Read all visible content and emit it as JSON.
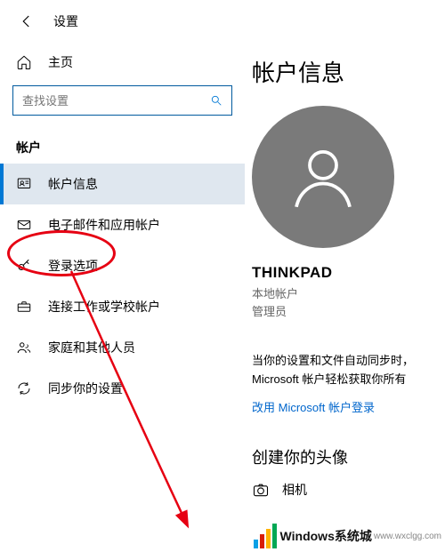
{
  "header": {
    "title": "设置"
  },
  "sidebar": {
    "home_label": "主页",
    "search_placeholder": "查找设置",
    "section_label": "帐户",
    "items": [
      {
        "label": "帐户信息",
        "icon": "account-info-icon",
        "selected": true
      },
      {
        "label": "电子邮件和应用帐户",
        "icon": "mail-icon",
        "selected": false
      },
      {
        "label": "登录选项",
        "icon": "key-icon",
        "selected": false
      },
      {
        "label": "连接工作或学校帐户",
        "icon": "briefcase-icon",
        "selected": false
      },
      {
        "label": "家庭和其他人员",
        "icon": "people-icon",
        "selected": false
      },
      {
        "label": "同步你的设置",
        "icon": "sync-icon",
        "selected": false
      }
    ]
  },
  "main": {
    "title": "帐户信息",
    "user": {
      "name": "THINKPAD",
      "type": "本地帐户",
      "role": "管理员"
    },
    "paragraph": "当你的设置和文件自动同步时，Microsoft 帐户轻松获取你所有",
    "link": "改用 Microsoft 帐户登录",
    "subhead": "创建你的头像",
    "camera_label": "相机"
  },
  "watermark": {
    "text1": "Windows系统城",
    "text2": "www.wxclgg.com"
  },
  "colors": {
    "accent": "#0078d4",
    "annotation": "#e60012"
  }
}
